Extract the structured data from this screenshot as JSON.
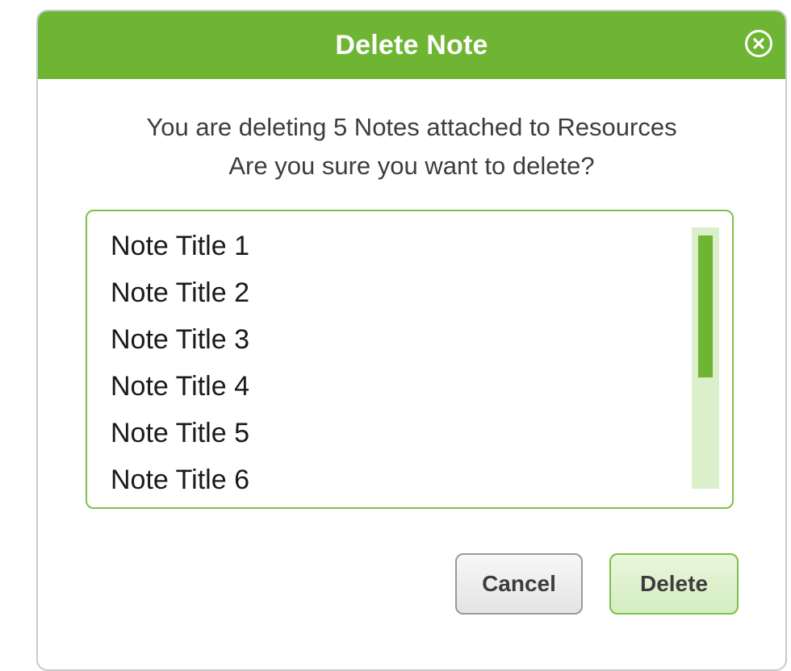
{
  "dialog": {
    "title": "Delete Note",
    "close_icon": "close-circle-icon",
    "message_line1": "You are deleting 5 Notes attached to Resources",
    "message_line2": "Are you sure you want to delete?",
    "notes": [
      "Note Title 1",
      "Note Title 2",
      "Note Title 3",
      "Note Title 4",
      "Note Title 5",
      "Note Title 6"
    ],
    "cancel_label": "Cancel",
    "delete_label": "Delete"
  },
  "colors": {
    "accent": "#6db533",
    "accent_light": "#dcefcb",
    "text": "#3d3d3d"
  }
}
